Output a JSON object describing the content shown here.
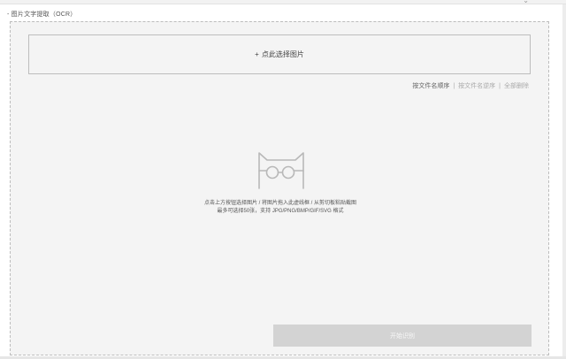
{
  "page": {
    "section_title": "- 图片文字提取（OCR）"
  },
  "uploader": {
    "select_plus": "+",
    "select_label": "点此选择图片",
    "sort_by_name": "按文件名顺序",
    "sort_separator_1": "|",
    "sort_by_name_desc": "按文件名逆序",
    "sort_separator_2": "|",
    "delete_all": "全部删除",
    "empty_icon": "cat-with-glasses-icon",
    "hint_line1": "点击上方按钮选择图片 / 将图片拖入此虚线框 / 从剪切板粘贴截图",
    "hint_line2": "最多可选择50张，支持 JPG/PNG/BMP/GIF/SVG 格式",
    "start_label": "开始识别"
  },
  "colors": {
    "panel_bg": "#f4f4f4",
    "border": "#bdbdbd",
    "button_disabled": "#d3d3d3",
    "text": "#555555"
  }
}
